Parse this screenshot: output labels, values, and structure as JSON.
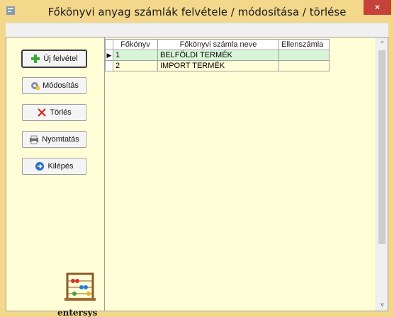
{
  "window": {
    "title": "Főkönyvi anyag számlák felvétele / módosítása / törlése",
    "close_label": "×"
  },
  "buttons": {
    "new": "Új felvétel",
    "modify": "Módosítás",
    "delete": "Törlés",
    "print": "Nyomtatás",
    "exit": "Kilépés"
  },
  "logo": {
    "text": "entersys"
  },
  "grid": {
    "columns": [
      "Főkönyv",
      "Főkönyvi számla neve",
      "Ellenszámla"
    ],
    "rows": [
      {
        "fokonyv": "1",
        "nev": "BELFÖLDI TERMÉK",
        "ellenszamla": ""
      },
      {
        "fokonyv": "2",
        "nev": "IMPORT TERMÉK",
        "ellenszamla": ""
      }
    ],
    "current_row_marker": "▶"
  },
  "scrollbar": {
    "up": "^",
    "down": "v"
  },
  "colors": {
    "accent": "#f3d78b",
    "panel": "#fffed6",
    "selected_row": "#d8f5d8",
    "close": "#c7413b"
  }
}
